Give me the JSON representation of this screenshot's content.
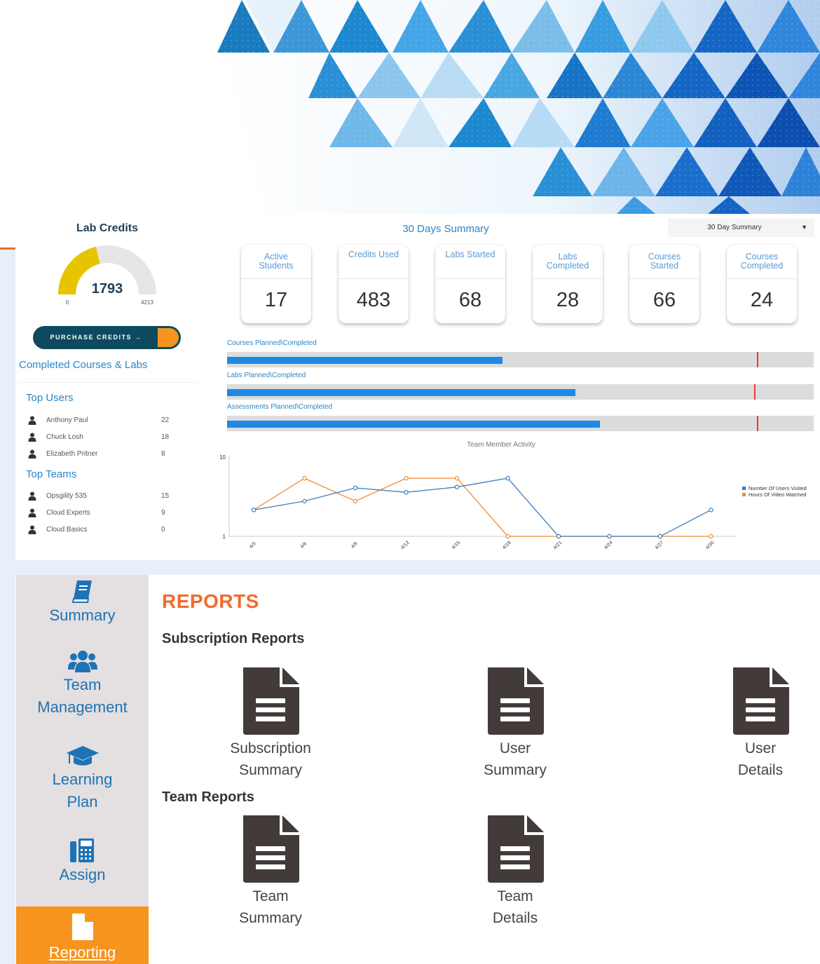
{
  "lab_credits": {
    "title": "Lab Credits",
    "value": "1793",
    "min": "0",
    "max": "4213",
    "fraction": 0.4256,
    "purchase_label": "PURCHASE CREDITS →",
    "completed_title": "Completed Courses & Labs"
  },
  "top_users": {
    "title": "Top Users",
    "items": [
      {
        "name": "Anthony Paul",
        "count": "22"
      },
      {
        "name": "Chuck Losh",
        "count": "18"
      },
      {
        "name": "Elizabeth Pritner",
        "count": "8"
      }
    ]
  },
  "top_teams": {
    "title": "Top Teams",
    "items": [
      {
        "name": "Opsgility 535",
        "count": "15"
      },
      {
        "name": "Cloud Experts",
        "count": "9"
      },
      {
        "name": "Cloud Basics",
        "count": "0"
      }
    ]
  },
  "summary": {
    "title": "30 Days Summary",
    "select_value": "30 Day Summary",
    "cards": [
      {
        "label1": "Active",
        "label2": "Students",
        "value": "17"
      },
      {
        "label1": "Credits Used",
        "label2": "",
        "value": "483"
      },
      {
        "label1": "Labs Started",
        "label2": "",
        "value": "68"
      },
      {
        "label1": "Labs",
        "label2": "Completed",
        "value": "28"
      },
      {
        "label1": "Courses",
        "label2": "Started",
        "value": "66"
      },
      {
        "label1": "Courses",
        "label2": "Completed",
        "value": "24"
      }
    ]
  },
  "progress": [
    {
      "label": "Courses Planned\\Completed",
      "completed_fraction": 0.47,
      "planned_fraction": 0.903
    },
    {
      "label": "Labs Planned\\Completed",
      "completed_fraction": 0.594,
      "planned_fraction": 0.899
    },
    {
      "label": "Assessments Planned\\Completed",
      "completed_fraction": 0.636,
      "planned_fraction": 0.903
    }
  ],
  "chart_data": {
    "type": "line",
    "title": "Team Member Activity",
    "x": [
      "4/3",
      "4/6",
      "4/9",
      "4/12",
      "4/15",
      "4/18",
      "4/21",
      "4/24",
      "4/27",
      "4/30"
    ],
    "ylim": [
      1,
      10
    ],
    "y_ticks": [
      "1",
      "10"
    ],
    "series": [
      {
        "name": "Number Of Users Visited",
        "color": "#3a7ebf",
        "values": [
          4,
          5,
          6.5,
          6,
          6.6,
          7.6,
          1,
          1,
          1,
          4
        ]
      },
      {
        "name": "Hours Of Video Watched",
        "color": "#f28a30",
        "values": [
          4,
          7.6,
          5,
          7.6,
          7.6,
          1,
          1,
          1,
          1,
          1
        ]
      }
    ],
    "legend": "right",
    "grid": false
  },
  "sidebar": {
    "items": [
      {
        "label1": "Summary",
        "label2": "",
        "icon": "book-icon"
      },
      {
        "label1": "Team",
        "label2": "Management",
        "icon": "users-icon"
      },
      {
        "label1": "Learning",
        "label2": "Plan",
        "icon": "graduation-cap-icon"
      },
      {
        "label1": "Assign",
        "label2": "",
        "icon": "fax-icon"
      },
      {
        "label1": "Reporting",
        "label2": "",
        "icon": "file-icon"
      }
    ],
    "active": "Reporting",
    "active_color": "#f7941d"
  },
  "reports": {
    "title": "REPORTS",
    "subscription_title": "Subscription Reports",
    "team_title": "Team Reports",
    "subscription_items": [
      {
        "line1": "Subscription",
        "line2": "Summary"
      },
      {
        "line1": "User",
        "line2": "Summary"
      },
      {
        "line1": "User",
        "line2": "Details"
      }
    ],
    "team_items": [
      {
        "line1": "Team",
        "line2": "Summary"
      },
      {
        "line1": "Team",
        "line2": "Details"
      }
    ],
    "title_color": "#f26a2e"
  }
}
